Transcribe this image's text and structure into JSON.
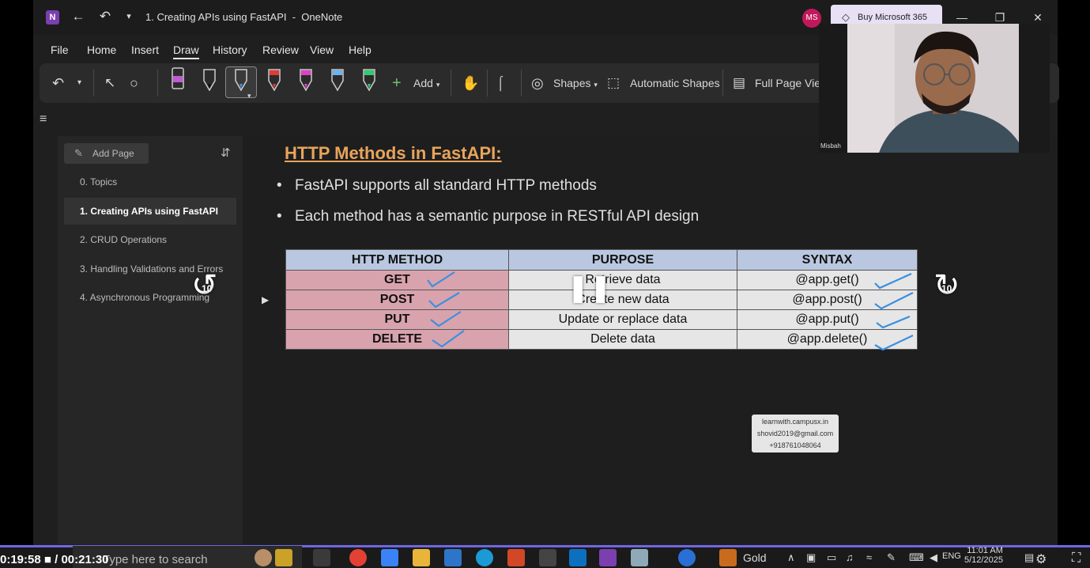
{
  "titlebar": {
    "app_icon": "N",
    "title": "1. Creating APIs using FastAPI  -  OneNote",
    "avatar_initials": "MS",
    "buy_label": "Buy Microsoft 365"
  },
  "menu": {
    "items": [
      "File",
      "Home",
      "Insert",
      "Draw",
      "History",
      "Review",
      "View",
      "Help"
    ],
    "active": "Draw"
  },
  "ribbon": {
    "add_label": "Add",
    "shapes_label": "Shapes",
    "automatic_shapes_label": "Automatic Shapes",
    "full_page_view_label": "Full Page View"
  },
  "pages": {
    "add_page_label": "Add Page",
    "items": [
      "0. Topics",
      "1. Creating APIs using FastAPI",
      "2. CRUD Operations",
      "3. Handling Validations and Errors",
      "4. Asynchronous Programming"
    ],
    "selected_index": 1
  },
  "note": {
    "heading": "HTTP Methods in FastAPI:",
    "bullets": [
      "FastAPI supports all standard HTTP methods",
      "Each method has a semantic purpose in RESTful API design"
    ],
    "table": {
      "headers": [
        "HTTP METHOD",
        "PURPOSE",
        "SYNTAX"
      ],
      "rows": [
        [
          "GET",
          "Retrieve data",
          "@app.get()"
        ],
        [
          "POST",
          "Create new data",
          "@app.post()"
        ],
        [
          "PUT",
          "Update or replace data",
          "@app.put()"
        ],
        [
          "DELETE",
          "Delete data",
          "@app.delete()"
        ]
      ]
    },
    "watermark": [
      "learnwith.campusx.in",
      "shovid2019@gmail.com",
      "+918761048064"
    ]
  },
  "video": {
    "skip_back": "10",
    "skip_forward": "10",
    "elapsed": "0:19:58",
    "duration": "00:21:30",
    "progress_fraction": 0.93
  },
  "webcam": {
    "name": "Misbah"
  },
  "taskbar": {
    "search_placeholder": "Type here to search",
    "weather": "Gold",
    "lang": "ENG",
    "time": "11:01 AM",
    "date": "5/12/2025"
  }
}
